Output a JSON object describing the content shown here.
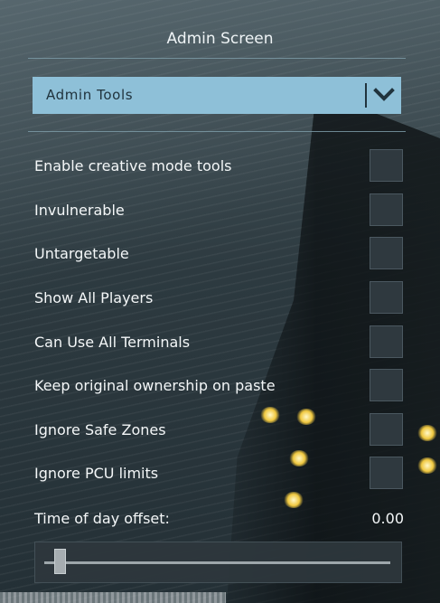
{
  "panel": {
    "title": "Admin Screen",
    "dropdown": {
      "selected": "Admin Tools",
      "icon": "chevron-down-icon"
    },
    "options": [
      {
        "label": "Enable creative mode tools",
        "checked": false
      },
      {
        "label": "Invulnerable",
        "checked": false
      },
      {
        "label": "Untargetable",
        "checked": false
      },
      {
        "label": "Show All Players",
        "checked": false
      },
      {
        "label": "Can Use All Terminals",
        "checked": false
      },
      {
        "label": "Keep original ownership on paste",
        "checked": false
      },
      {
        "label": "Ignore Safe Zones",
        "checked": false
      },
      {
        "label": "Ignore PCU limits",
        "checked": false
      }
    ],
    "time_of_day": {
      "label": "Time of day offset:",
      "value_text": "0.00",
      "slider_fraction": 0.03
    }
  },
  "colors": {
    "accent": "#8ec0d8",
    "dropdown_text": "#20333d",
    "checkbox_bg": "#323c42",
    "text": "#f4f7f8"
  }
}
